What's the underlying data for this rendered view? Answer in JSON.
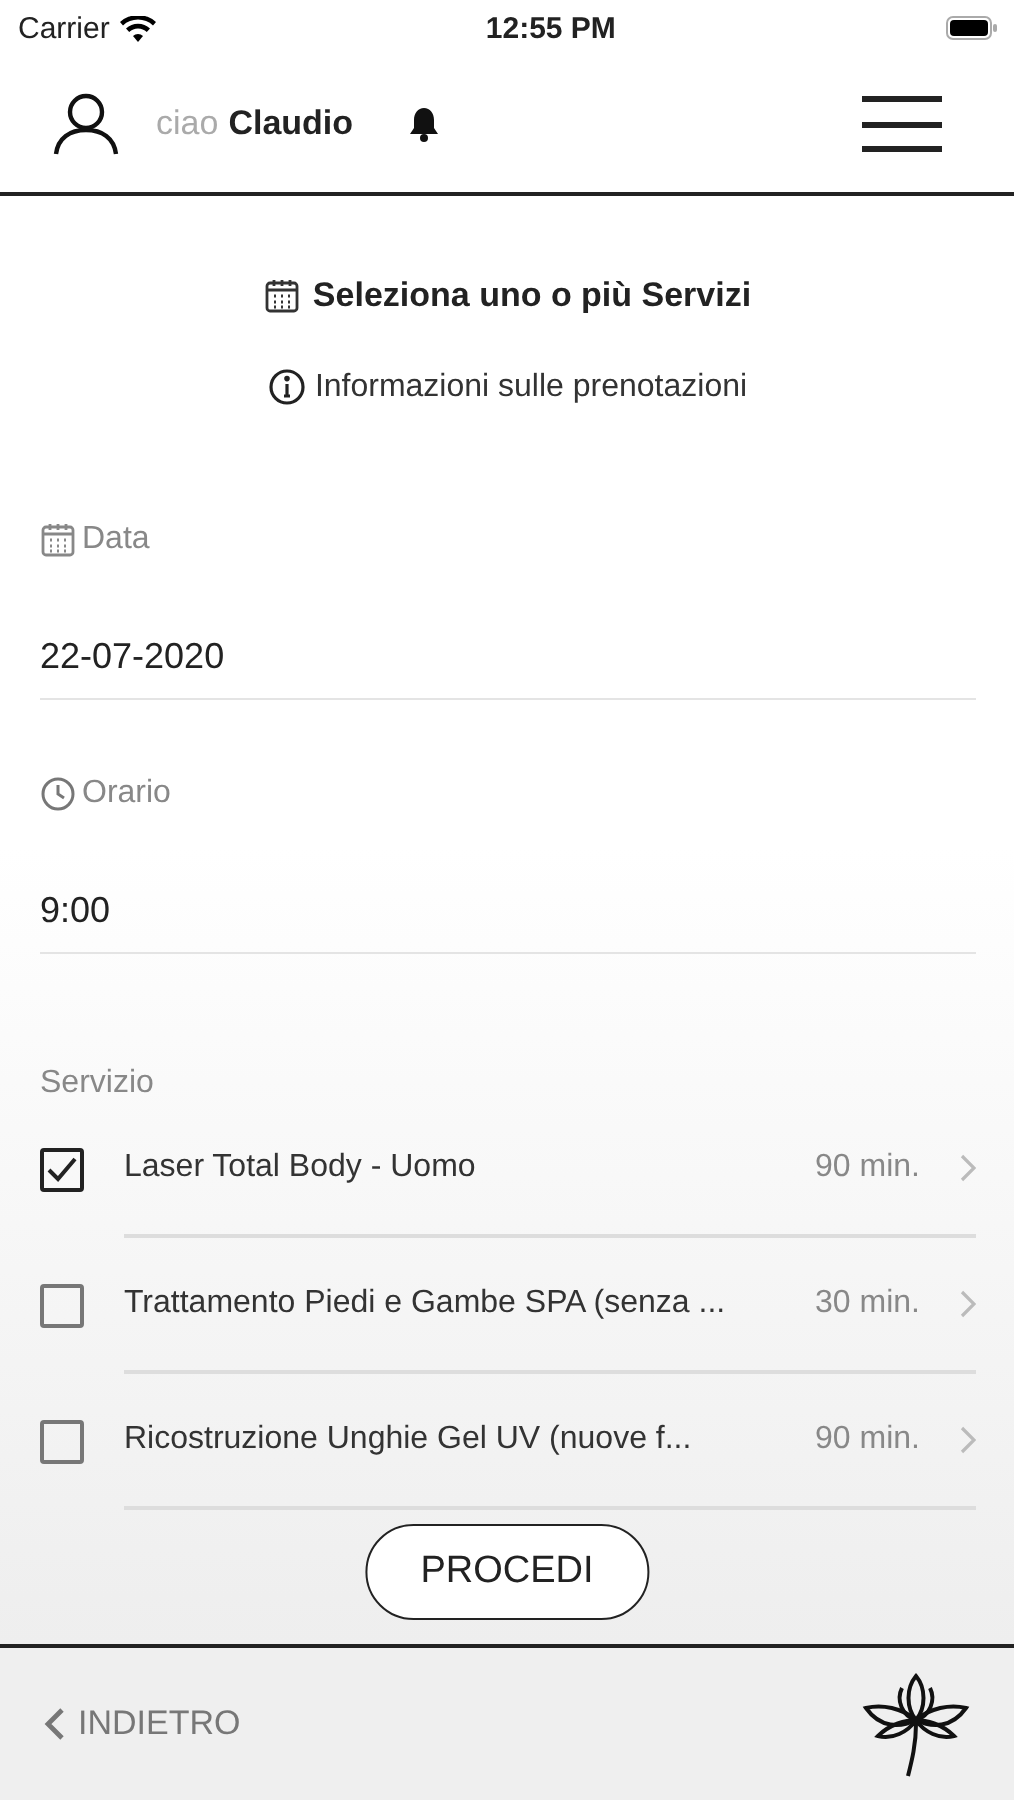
{
  "status_bar": {
    "carrier": "Carrier",
    "time": "12:55 PM"
  },
  "header": {
    "greeting": "ciao",
    "name": "Claudio"
  },
  "title": "Seleziona uno o più Servizi",
  "info_link": "Informazioni sulle prenotazioni",
  "fields": [
    {
      "kind": "date",
      "label": "Data",
      "value": "22-07-2020"
    },
    {
      "kind": "time",
      "label": "Orario",
      "value": "9:00"
    }
  ],
  "services": {
    "label": "Servizio",
    "items": [
      {
        "name": "Laser Total Body - Uomo",
        "duration": "90 min.",
        "checked": true
      },
      {
        "name": "Trattamento Piedi e Gambe SPA (senza ...",
        "duration": "30 min.",
        "checked": false
      },
      {
        "name": "Ricostruzione Unghie Gel UV (nuove f...",
        "duration": "90 min.",
        "checked": false
      }
    ]
  },
  "proceed_button": "PROCEDI",
  "footer": {
    "back": "INDIETRO"
  }
}
